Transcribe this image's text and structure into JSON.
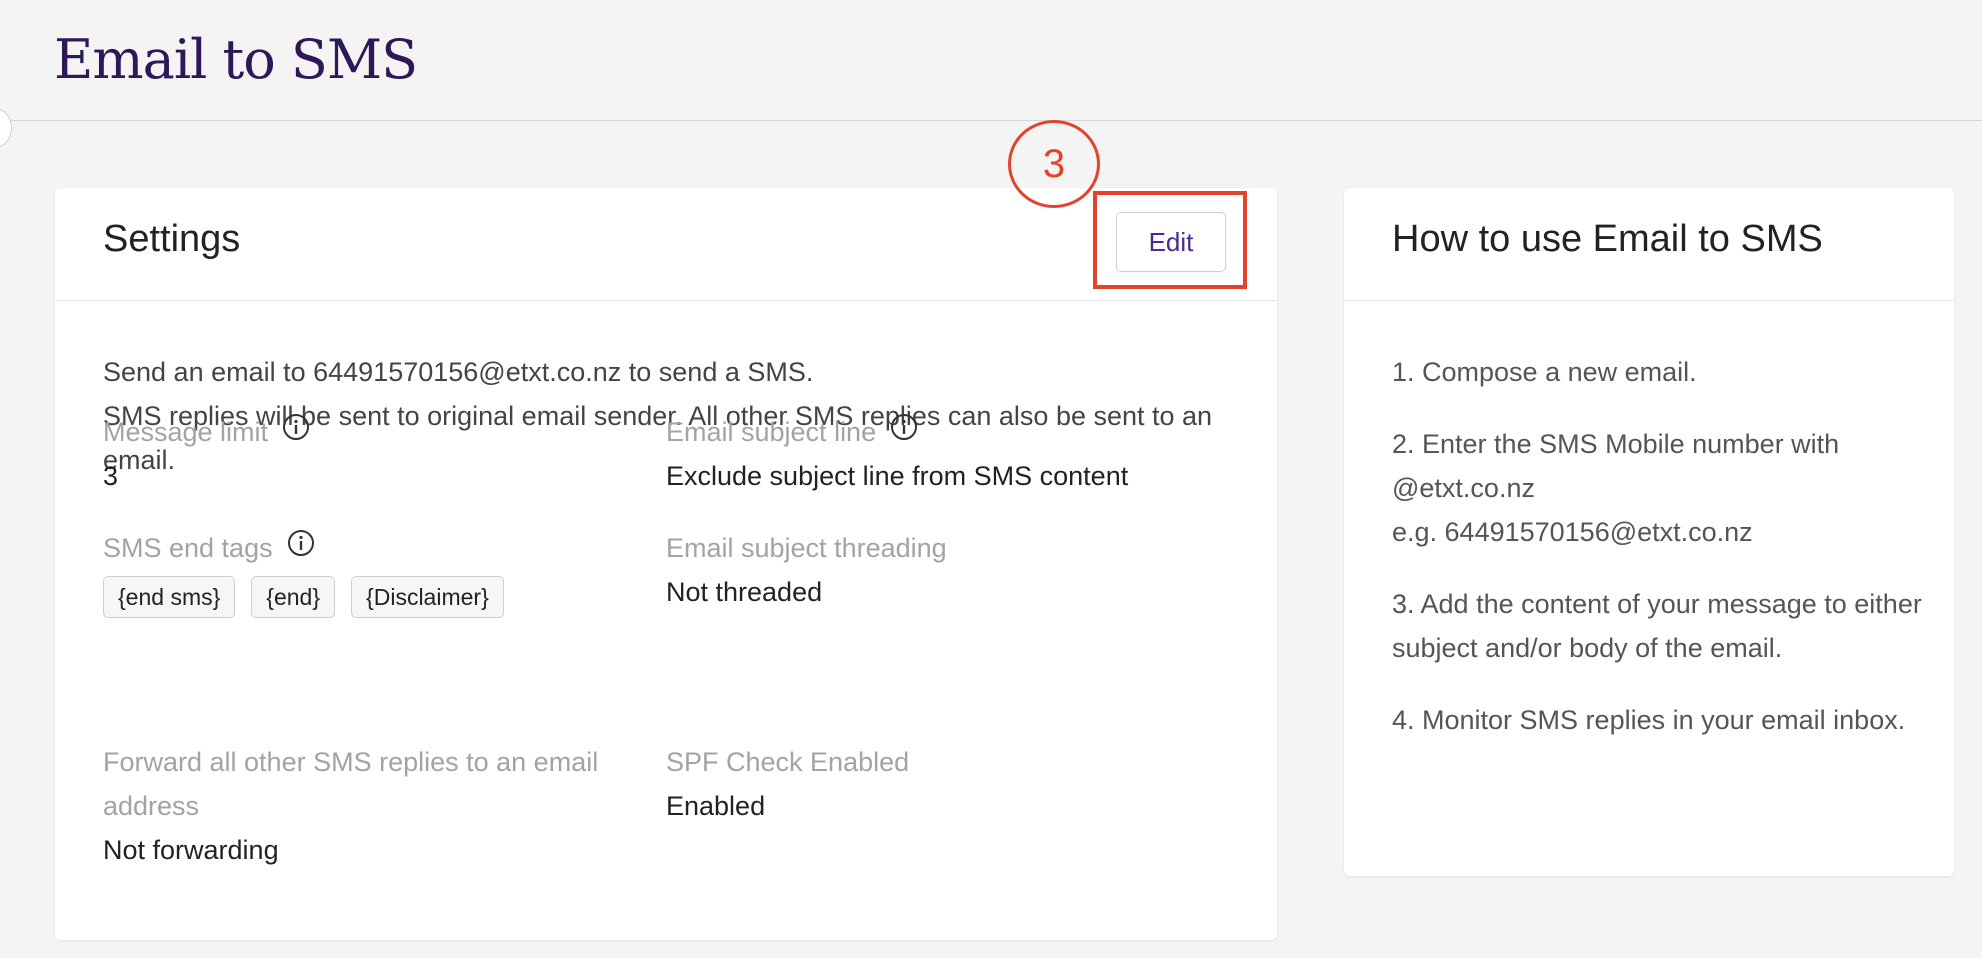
{
  "page": {
    "title": "Email to SMS"
  },
  "settings": {
    "title": "Settings",
    "edit_label": "Edit",
    "annotation_number": "3",
    "intro_line1": "Send an email to 64491570156@etxt.co.nz to send a SMS.",
    "intro_line2": "SMS replies will be sent to original email sender. All other SMS replies can also be sent to an email.",
    "fields": {
      "message_limit": {
        "label": "Message limit",
        "value": "3"
      },
      "sms_end_tags": {
        "label": "SMS end tags",
        "tags": [
          "{end sms}",
          "{end}",
          "{Disclaimer}"
        ]
      },
      "forward_replies": {
        "label": "Forward all other SMS replies to an email address",
        "value": "Not forwarding"
      },
      "email_subject_line": {
        "label": "Email subject line",
        "value": "Exclude subject line from SMS content"
      },
      "email_subject_threading": {
        "label": "Email subject threading",
        "value": "Not threaded"
      },
      "spf_check": {
        "label": "SPF Check Enabled",
        "value": "Enabled"
      }
    }
  },
  "howto": {
    "title": "How to use Email to SMS",
    "steps": [
      {
        "line1": "1. Compose a new email."
      },
      {
        "line1": "2. Enter the SMS Mobile number with @etxt.co.nz",
        "line2": "e.g. 64491570156@etxt.co.nz"
      },
      {
        "line1": "3. Add the content of your message to either subject and/or body of the email."
      },
      {
        "line1": "4. Monitor SMS replies in your email inbox."
      }
    ]
  },
  "colors": {
    "title": "#2e1858",
    "accent": "#4a2a92",
    "annotation": "#e3432d",
    "muted_label": "#a3a3a3"
  },
  "icons": {
    "info": "info-circle-icon"
  }
}
